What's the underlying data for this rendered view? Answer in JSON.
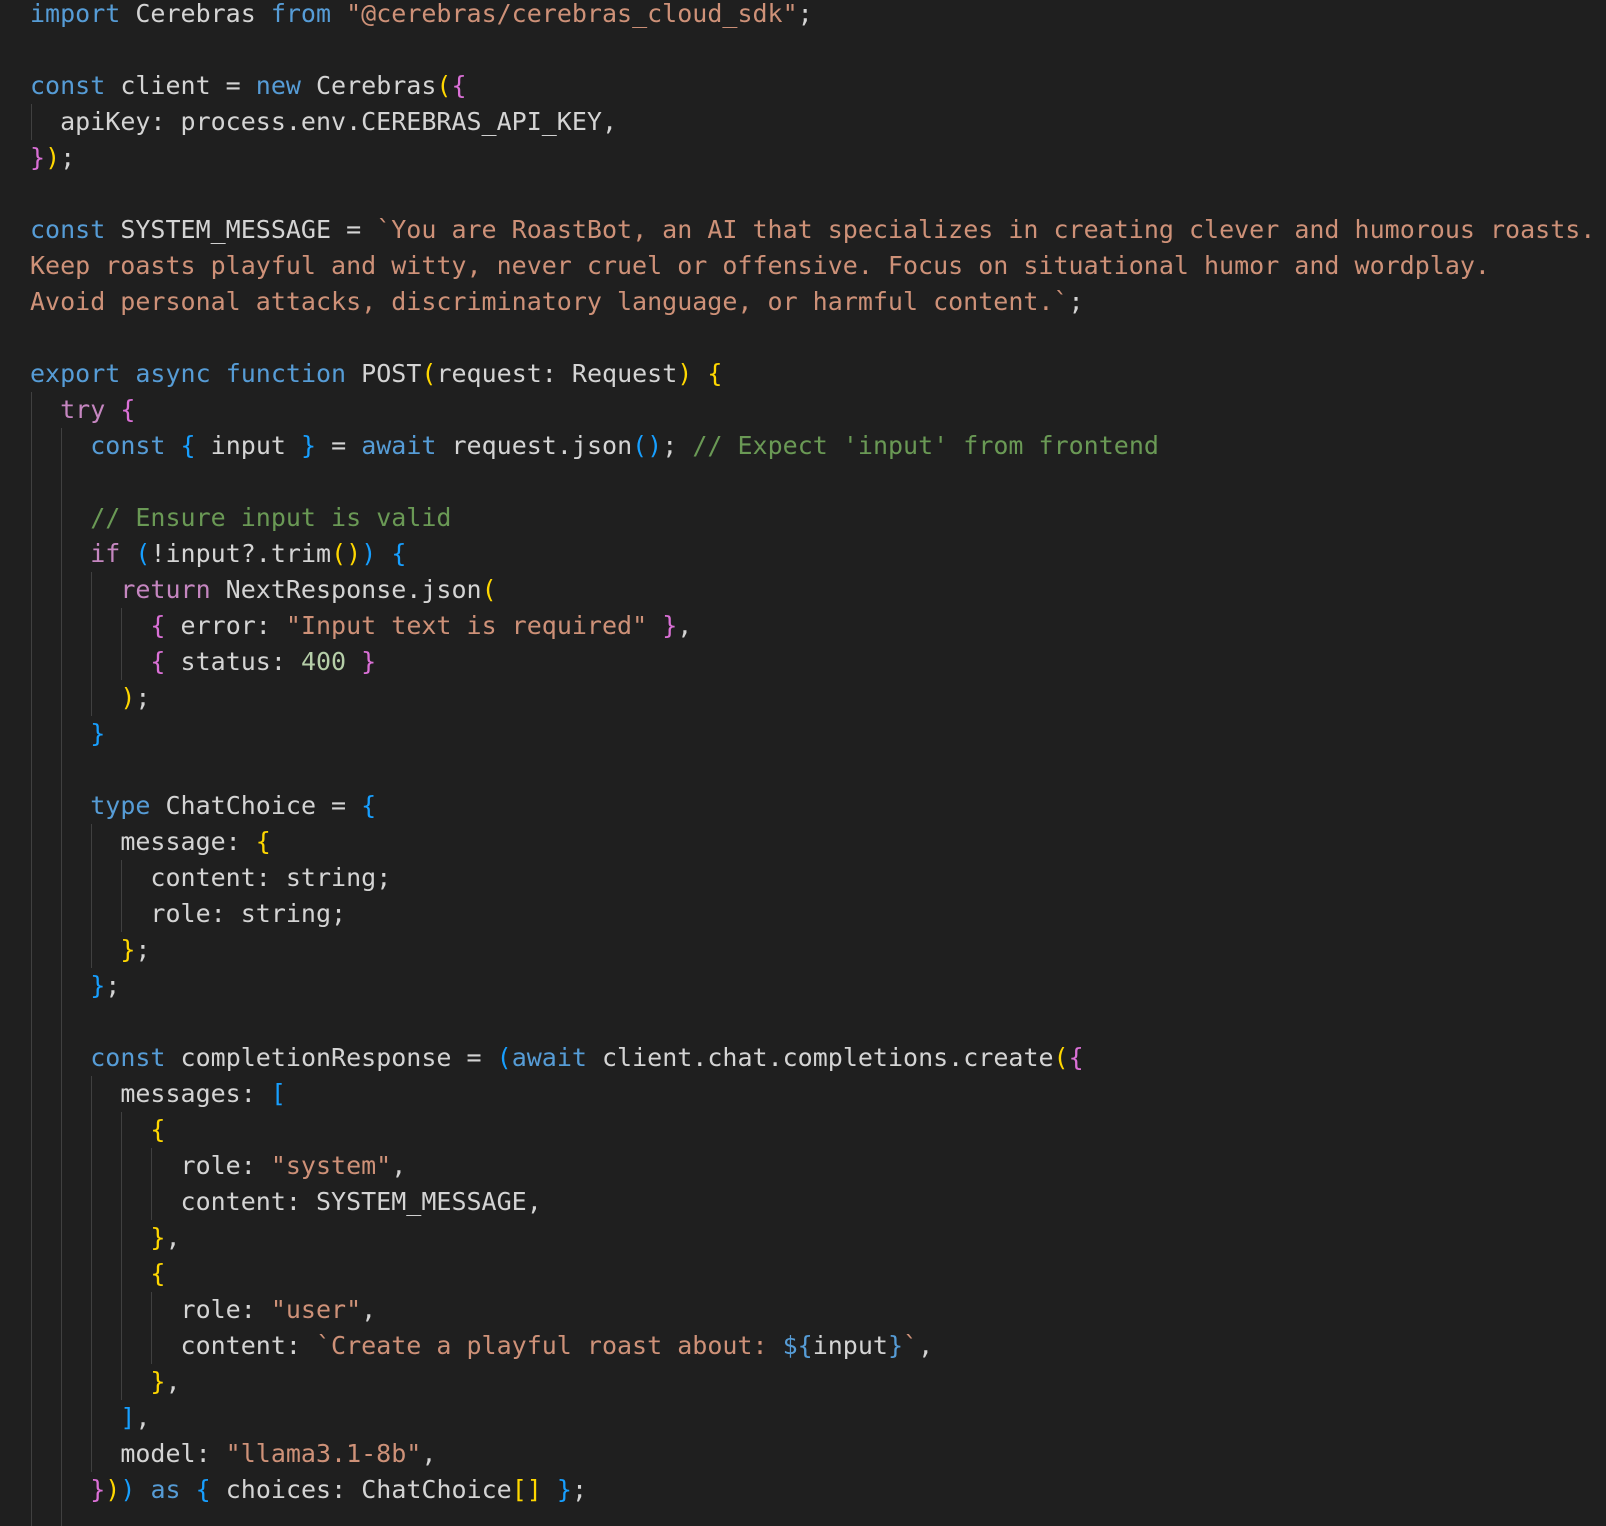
{
  "editor": {
    "language": "typescript",
    "colors": {
      "background": "#1f1f1f",
      "foreground": "#d4d4d4",
      "keyword": "#569cd6",
      "control": "#c586c0",
      "string": "#ce9178",
      "number": "#b5cea8",
      "comment": "#6a9955",
      "function": "#dcdcaa",
      "bracket_level_1": "#ffd700",
      "bracket_level_2": "#da70d6",
      "bracket_level_3": "#179fff",
      "indent_guide": "#404040"
    }
  },
  "lines": [
    {
      "indent": 0,
      "tokens": [
        [
          "kw",
          "import"
        ],
        [
          "plain",
          " Cerebras "
        ],
        [
          "kw",
          "from"
        ],
        [
          "plain",
          " "
        ],
        [
          "str",
          "\"@cerebras/cerebras_cloud_sdk\""
        ],
        [
          "plain",
          ";"
        ]
      ]
    },
    {
      "indent": 0,
      "tokens": []
    },
    {
      "indent": 0,
      "tokens": [
        [
          "kw",
          "const"
        ],
        [
          "plain",
          " client = "
        ],
        [
          "kw",
          "new"
        ],
        [
          "plain",
          " Cerebras"
        ],
        [
          "p1",
          "("
        ],
        [
          "p2",
          "{"
        ]
      ]
    },
    {
      "indent": 1,
      "tokens": [
        [
          "plain",
          "apiKey: process.env.CEREBRAS_API_KEY,"
        ]
      ]
    },
    {
      "indent": 0,
      "tokens": [
        [
          "p2",
          "}"
        ],
        [
          "p1",
          ")"
        ],
        [
          "plain",
          ";"
        ]
      ]
    },
    {
      "indent": 0,
      "tokens": []
    },
    {
      "indent": 0,
      "tokens": [
        [
          "kw",
          "const"
        ],
        [
          "plain",
          " SYSTEM_MESSAGE = "
        ],
        [
          "str",
          "`You are RoastBot, an AI that specializes in creating clever and humorous roasts."
        ]
      ]
    },
    {
      "indent": 0,
      "tokens": [
        [
          "str",
          "Keep roasts playful and witty, never cruel or offensive. Focus on situational humor and wordplay."
        ]
      ]
    },
    {
      "indent": 0,
      "tokens": [
        [
          "str",
          "Avoid personal attacks, discriminatory language, or harmful content.`"
        ],
        [
          "plain",
          ";"
        ]
      ]
    },
    {
      "indent": 0,
      "tokens": []
    },
    {
      "indent": 0,
      "tokens": [
        [
          "kw",
          "export"
        ],
        [
          "plain",
          " "
        ],
        [
          "kw",
          "async"
        ],
        [
          "plain",
          " "
        ],
        [
          "kw",
          "function"
        ],
        [
          "plain",
          " POST"
        ],
        [
          "p1",
          "("
        ],
        [
          "plain",
          "request: Request"
        ],
        [
          "p1",
          ")"
        ],
        [
          "plain",
          " "
        ],
        [
          "p1",
          "{"
        ]
      ]
    },
    {
      "indent": 1,
      "tokens": [
        [
          "ctl",
          "try"
        ],
        [
          "plain",
          " "
        ],
        [
          "p2",
          "{"
        ]
      ]
    },
    {
      "indent": 2,
      "tokens": [
        [
          "kw",
          "const"
        ],
        [
          "plain",
          " "
        ],
        [
          "p3",
          "{"
        ],
        [
          "plain",
          " input "
        ],
        [
          "p3",
          "}"
        ],
        [
          "plain",
          " = "
        ],
        [
          "kw",
          "await"
        ],
        [
          "plain",
          " request.json"
        ],
        [
          "p3",
          "()"
        ],
        [
          "plain",
          "; "
        ],
        [
          "cmt",
          "// Expect 'input' from frontend"
        ]
      ]
    },
    {
      "indent": 2,
      "tokens": []
    },
    {
      "indent": 2,
      "tokens": [
        [
          "cmt",
          "// Ensure input is valid"
        ]
      ]
    },
    {
      "indent": 2,
      "tokens": [
        [
          "ctl",
          "if"
        ],
        [
          "plain",
          " "
        ],
        [
          "p3",
          "("
        ],
        [
          "plain",
          "!input?.trim"
        ],
        [
          "p1",
          "()"
        ],
        [
          "p3",
          ")"
        ],
        [
          "plain",
          " "
        ],
        [
          "p3",
          "{"
        ]
      ]
    },
    {
      "indent": 3,
      "tokens": [
        [
          "ctl",
          "return"
        ],
        [
          "plain",
          " NextResponse.json"
        ],
        [
          "p1",
          "("
        ]
      ]
    },
    {
      "indent": 4,
      "tokens": [
        [
          "p2",
          "{"
        ],
        [
          "plain",
          " error: "
        ],
        [
          "str",
          "\"Input text is required\""
        ],
        [
          "plain",
          " "
        ],
        [
          "p2",
          "}"
        ],
        [
          "plain",
          ","
        ]
      ]
    },
    {
      "indent": 4,
      "tokens": [
        [
          "p2",
          "{"
        ],
        [
          "plain",
          " status: "
        ],
        [
          "num",
          "400"
        ],
        [
          "plain",
          " "
        ],
        [
          "p2",
          "}"
        ]
      ]
    },
    {
      "indent": 3,
      "tokens": [
        [
          "p1",
          ")"
        ],
        [
          "plain",
          ";"
        ]
      ]
    },
    {
      "indent": 2,
      "tokens": [
        [
          "p3",
          "}"
        ]
      ]
    },
    {
      "indent": 2,
      "tokens": []
    },
    {
      "indent": 2,
      "tokens": [
        [
          "kw",
          "type"
        ],
        [
          "plain",
          " ChatChoice = "
        ],
        [
          "p3",
          "{"
        ]
      ]
    },
    {
      "indent": 3,
      "tokens": [
        [
          "plain",
          "message: "
        ],
        [
          "p1",
          "{"
        ]
      ]
    },
    {
      "indent": 4,
      "tokens": [
        [
          "plain",
          "content: string;"
        ]
      ]
    },
    {
      "indent": 4,
      "tokens": [
        [
          "plain",
          "role: string;"
        ]
      ]
    },
    {
      "indent": 3,
      "tokens": [
        [
          "p1",
          "}"
        ],
        [
          "plain",
          ";"
        ]
      ]
    },
    {
      "indent": 2,
      "tokens": [
        [
          "p3",
          "}"
        ],
        [
          "plain",
          ";"
        ]
      ]
    },
    {
      "indent": 2,
      "tokens": []
    },
    {
      "indent": 2,
      "tokens": [
        [
          "kw",
          "const"
        ],
        [
          "plain",
          " completionResponse = "
        ],
        [
          "p3",
          "("
        ],
        [
          "kw",
          "await"
        ],
        [
          "plain",
          " client.chat.completions.create"
        ],
        [
          "p1",
          "("
        ],
        [
          "p2",
          "{"
        ]
      ]
    },
    {
      "indent": 3,
      "tokens": [
        [
          "plain",
          "messages: "
        ],
        [
          "p3",
          "["
        ]
      ]
    },
    {
      "indent": 4,
      "tokens": [
        [
          "p1",
          "{"
        ]
      ]
    },
    {
      "indent": 5,
      "tokens": [
        [
          "plain",
          "role: "
        ],
        [
          "str",
          "\"system\""
        ],
        [
          "plain",
          ","
        ]
      ]
    },
    {
      "indent": 5,
      "tokens": [
        [
          "plain",
          "content: SYSTEM_MESSAGE,"
        ]
      ]
    },
    {
      "indent": 4,
      "tokens": [
        [
          "p1",
          "}"
        ],
        [
          "plain",
          ","
        ]
      ]
    },
    {
      "indent": 4,
      "tokens": [
        [
          "p1",
          "{"
        ]
      ]
    },
    {
      "indent": 5,
      "tokens": [
        [
          "plain",
          "role: "
        ],
        [
          "str",
          "\"user\""
        ],
        [
          "plain",
          ","
        ]
      ]
    },
    {
      "indent": 5,
      "tokens": [
        [
          "plain",
          "content: "
        ],
        [
          "str",
          "`Create a playful roast about: "
        ],
        [
          "kw",
          "${"
        ],
        [
          "plain",
          "input"
        ],
        [
          "kw",
          "}"
        ],
        [
          "str",
          "`"
        ],
        [
          "plain",
          ","
        ]
      ]
    },
    {
      "indent": 4,
      "tokens": [
        [
          "p1",
          "}"
        ],
        [
          "plain",
          ","
        ]
      ]
    },
    {
      "indent": 3,
      "tokens": [
        [
          "p3",
          "]"
        ],
        [
          "plain",
          ","
        ]
      ]
    },
    {
      "indent": 3,
      "tokens": [
        [
          "plain",
          "model: "
        ],
        [
          "str",
          "\"llama3.1-8b\""
        ],
        [
          "plain",
          ","
        ]
      ]
    },
    {
      "indent": 2,
      "tokens": [
        [
          "p2",
          "}"
        ],
        [
          "p1",
          ")"
        ],
        [
          "p3",
          ")"
        ],
        [
          "plain",
          " "
        ],
        [
          "kw",
          "as"
        ],
        [
          "plain",
          " "
        ],
        [
          "p3",
          "{"
        ],
        [
          "plain",
          " choices: ChatChoice"
        ],
        [
          "p1",
          "[]"
        ],
        [
          "plain",
          " "
        ],
        [
          "p3",
          "}"
        ],
        [
          "plain",
          ";"
        ]
      ]
    },
    {
      "indent": 2,
      "tokens": []
    }
  ]
}
